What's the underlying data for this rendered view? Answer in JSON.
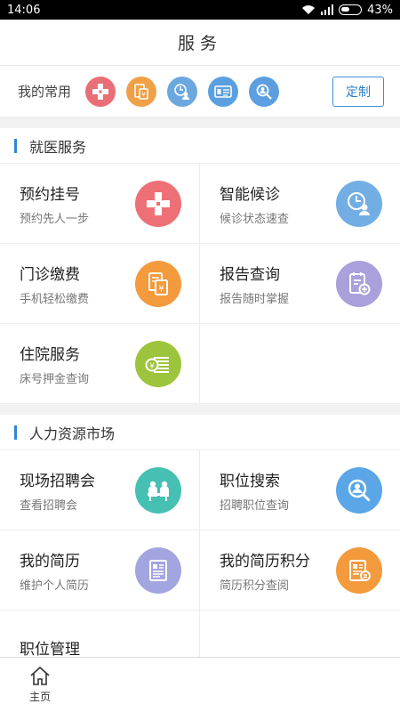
{
  "status_bar": {
    "time": "14:06",
    "battery": "43%"
  },
  "header": {
    "title": "服务"
  },
  "favorites": {
    "label": "我的常用",
    "custom_button": "定制",
    "icons": [
      {
        "name": "hospital-cross-icon",
        "color": "#e96e76"
      },
      {
        "name": "payment-doc-icon",
        "color": "#f0a046"
      },
      {
        "name": "queue-clock-icon",
        "color": "#6aa8de"
      },
      {
        "name": "id-card-icon",
        "color": "#5aa0e0"
      },
      {
        "name": "search-person-icon",
        "color": "#5c9fe0"
      }
    ]
  },
  "sections": [
    {
      "title": "就医服务",
      "items": [
        {
          "title": "预约挂号",
          "subtitle": "预约先人一步",
          "icon": "hospital-cross-icon",
          "color": "#ee7077"
        },
        {
          "title": "智能候诊",
          "subtitle": "候诊状态速查",
          "icon": "queue-clock-icon",
          "color": "#72aee4"
        },
        {
          "title": "门诊缴费",
          "subtitle": "手机轻松缴费",
          "icon": "payment-doc-icon",
          "color": "#f39a3d"
        },
        {
          "title": "报告查询",
          "subtitle": "报告随时掌握",
          "icon": "report-check-icon",
          "color": "#a9a0dc"
        },
        {
          "title": "住院服务",
          "subtitle": "床号押金查询",
          "icon": "money-stack-icon",
          "color": "#9dc43d"
        }
      ]
    },
    {
      "title": "人力资源市场",
      "items": [
        {
          "title": "现场招聘会",
          "subtitle": "查看招聘会",
          "icon": "job-fair-icon",
          "color": "#45c0b2"
        },
        {
          "title": "职位搜索",
          "subtitle": "招聘职位查询",
          "icon": "search-person-icon",
          "color": "#5aa6e6"
        },
        {
          "title": "我的简历",
          "subtitle": "维护个人简历",
          "icon": "resume-icon",
          "color": "#a3a5e0"
        },
        {
          "title": "我的简历积分",
          "subtitle": "简历积分查阅",
          "icon": "resume-points-icon",
          "color": "#f39a3d"
        },
        {
          "title": "职位管理",
          "subtitle": "",
          "icon": "",
          "color": ""
        }
      ]
    }
  ],
  "tab_bar": {
    "home_label": "主页"
  }
}
